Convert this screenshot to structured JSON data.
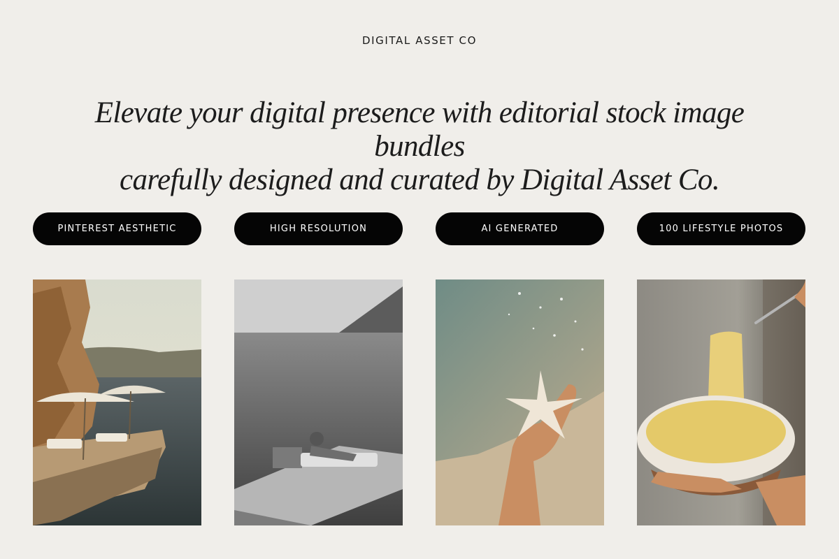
{
  "brand": "DIGITAL ASSET CO",
  "headline": {
    "line1": "Elevate your digital presence with editorial stock image bundles",
    "line2": "carefully designed and curated by Digital Asset Co."
  },
  "features": [
    {
      "label": "PINTEREST AESTHETIC"
    },
    {
      "label": "HIGH RESOLUTION"
    },
    {
      "label": "AI GENERATED"
    },
    {
      "label": "100 LIFESTYLE PHOTOS"
    }
  ],
  "colors": {
    "background": "#f0eeea",
    "pill": "#050505",
    "pill_text": "#ffffff"
  }
}
